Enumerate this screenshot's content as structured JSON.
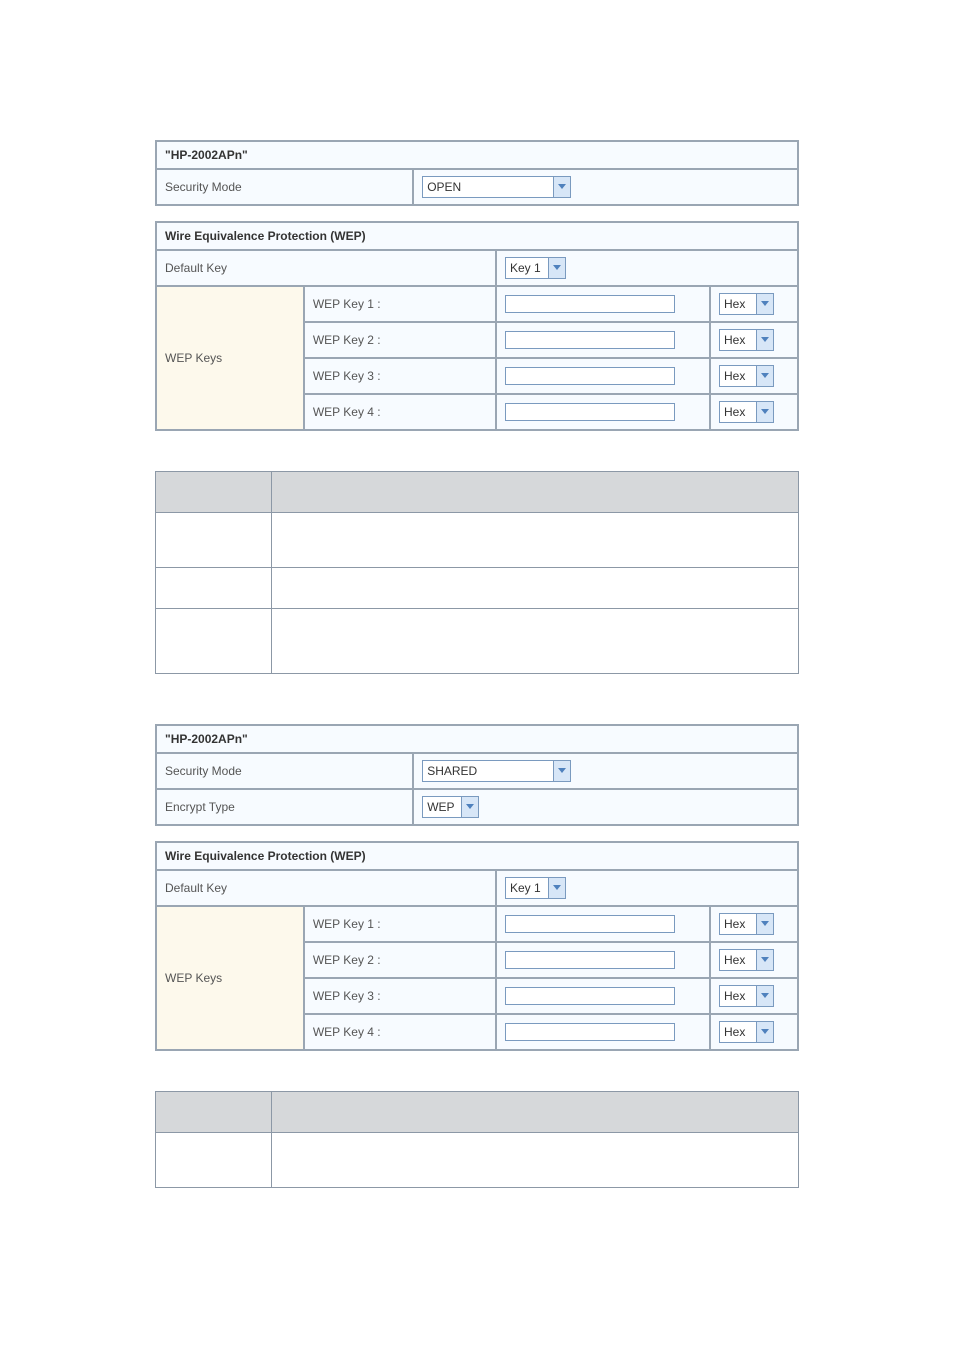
{
  "block1": {
    "ssid_header": "\"HP-2002APn\"",
    "security_mode_label": "Security Mode",
    "security_mode_value": "OPEN",
    "wep_header": "Wire Equivalence Protection (WEP)",
    "default_key_label": "Default Key",
    "default_key_value": "Key 1",
    "wep_keys_label": "WEP Keys",
    "keys": [
      {
        "label": "WEP Key 1 :",
        "value": "",
        "type": "Hex"
      },
      {
        "label": "WEP Key 2 :",
        "value": "",
        "type": "Hex"
      },
      {
        "label": "WEP Key 3 :",
        "value": "",
        "type": "Hex"
      },
      {
        "label": "WEP Key 4 :",
        "value": "",
        "type": "Hex"
      }
    ]
  },
  "block2": {
    "ssid_header": "\"HP-2002APn\"",
    "security_mode_label": "Security Mode",
    "security_mode_value": "SHARED",
    "encrypt_type_label": "Encrypt Type",
    "encrypt_type_value": "WEP",
    "wep_header": "Wire Equivalence Protection (WEP)",
    "default_key_label": "Default Key",
    "default_key_value": "Key 1",
    "wep_keys_label": "WEP Keys",
    "keys": [
      {
        "label": "WEP Key 1 :",
        "value": "",
        "type": "Hex"
      },
      {
        "label": "WEP Key 2 :",
        "value": "",
        "type": "Hex"
      },
      {
        "label": "WEP Key 3 :",
        "value": "",
        "type": "Hex"
      },
      {
        "label": "WEP Key 4 :",
        "value": "",
        "type": "Hex"
      }
    ]
  }
}
